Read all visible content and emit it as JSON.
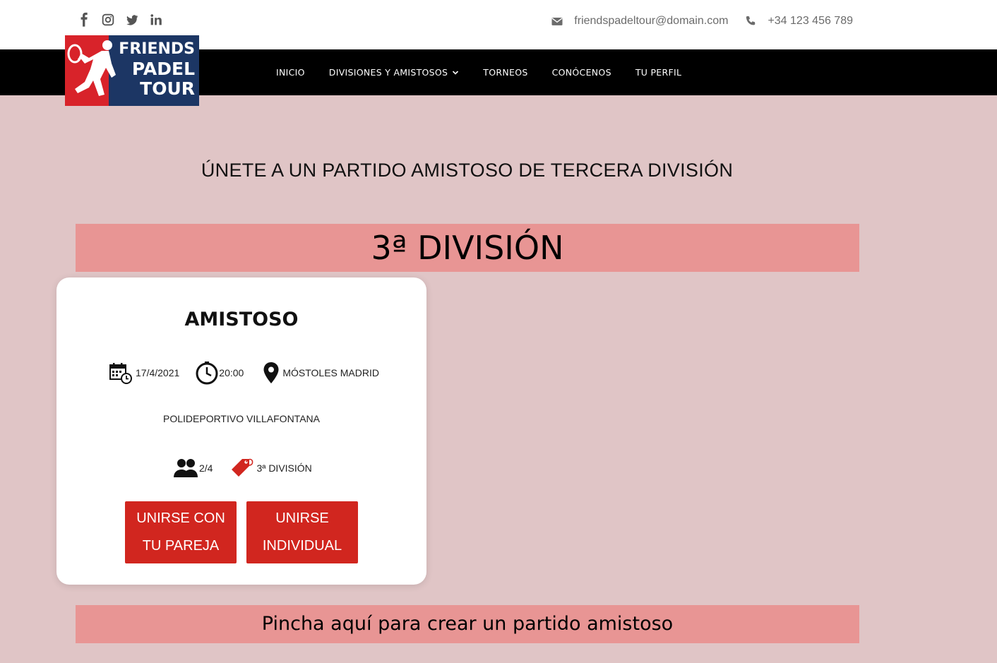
{
  "header": {
    "social": [
      {
        "icon": "facebook-icon"
      },
      {
        "icon": "instagram-icon"
      },
      {
        "icon": "twitter-icon"
      },
      {
        "icon": "linkedin-icon"
      }
    ],
    "email": "friendspadeltour@domain.com",
    "phone": "+34 123 456 789"
  },
  "logo": {
    "line1": "FRIENDS",
    "line2": "PADEL",
    "line3": "TOUR",
    "colors": {
      "navy": "#1c3664",
      "red": "#d8232a"
    }
  },
  "nav": {
    "items": [
      {
        "label": "INICIO"
      },
      {
        "label": "DIVISIONES Y AMISTOSOS",
        "has_dropdown": true
      },
      {
        "label": "TORNEOS"
      },
      {
        "label": "CONÓCENOS"
      },
      {
        "label": "TU PERFIL"
      }
    ]
  },
  "main": {
    "heading": "ÚNETE A UN PARTIDO AMISTOSO DE TERCERA DIVISIÓN",
    "division_banner": "3ª DIVISIÓN",
    "create_link": "Pincha aquí para crear un partido amistoso"
  },
  "match_card": {
    "title": "AMISTOSO",
    "date": "17/4/2021",
    "time": "20:00",
    "location": "MÓSTOLES MADRID",
    "venue": "POLIDEPORTIVO VILLAFONTANA",
    "players": "2/4",
    "division": "3ª DIVISIÓN",
    "join_pair_label": [
      "UNIRSE CON",
      "TU PAREJA"
    ],
    "join_individual_label": [
      "UNIRSE",
      "INDIVIDUAL"
    ]
  },
  "colors": {
    "background": "#e0c5c6",
    "banner": "#e89594",
    "button": "#d1261f",
    "navbar": "#000000"
  }
}
